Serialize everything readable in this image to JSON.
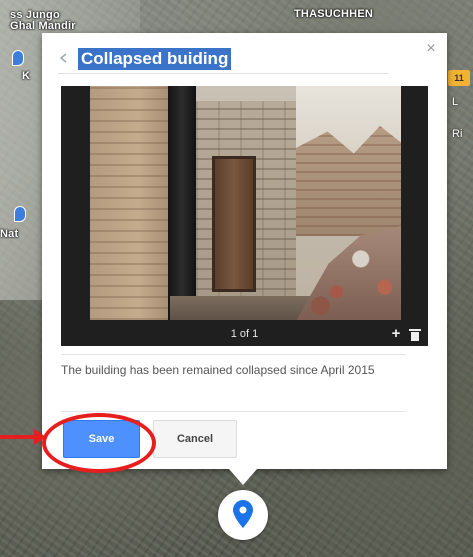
{
  "map": {
    "label_top_left": "ss Jungo Ghal Mandir",
    "label_top_center": "THASUCHHEN",
    "label_left_k": "K",
    "label_left_mid": "Nat",
    "right_badge": "11",
    "right_char_1": "L",
    "right_char_2": "Ri"
  },
  "infowindow": {
    "title": "Collapsed buiding",
    "back_icon": "back-arrow-icon",
    "close_label": "×",
    "photo": {
      "counter": "1 of 1",
      "add_label": "+"
    },
    "description": "The building has been remained collapsed since April 2015",
    "save_label": "Save",
    "cancel_label": "Cancel"
  },
  "colors": {
    "save_button": "#4d90fe",
    "title_highlight": "#3b73c8",
    "annotation_red": "#e61e1e",
    "marker_blue": "#1a73e8"
  }
}
